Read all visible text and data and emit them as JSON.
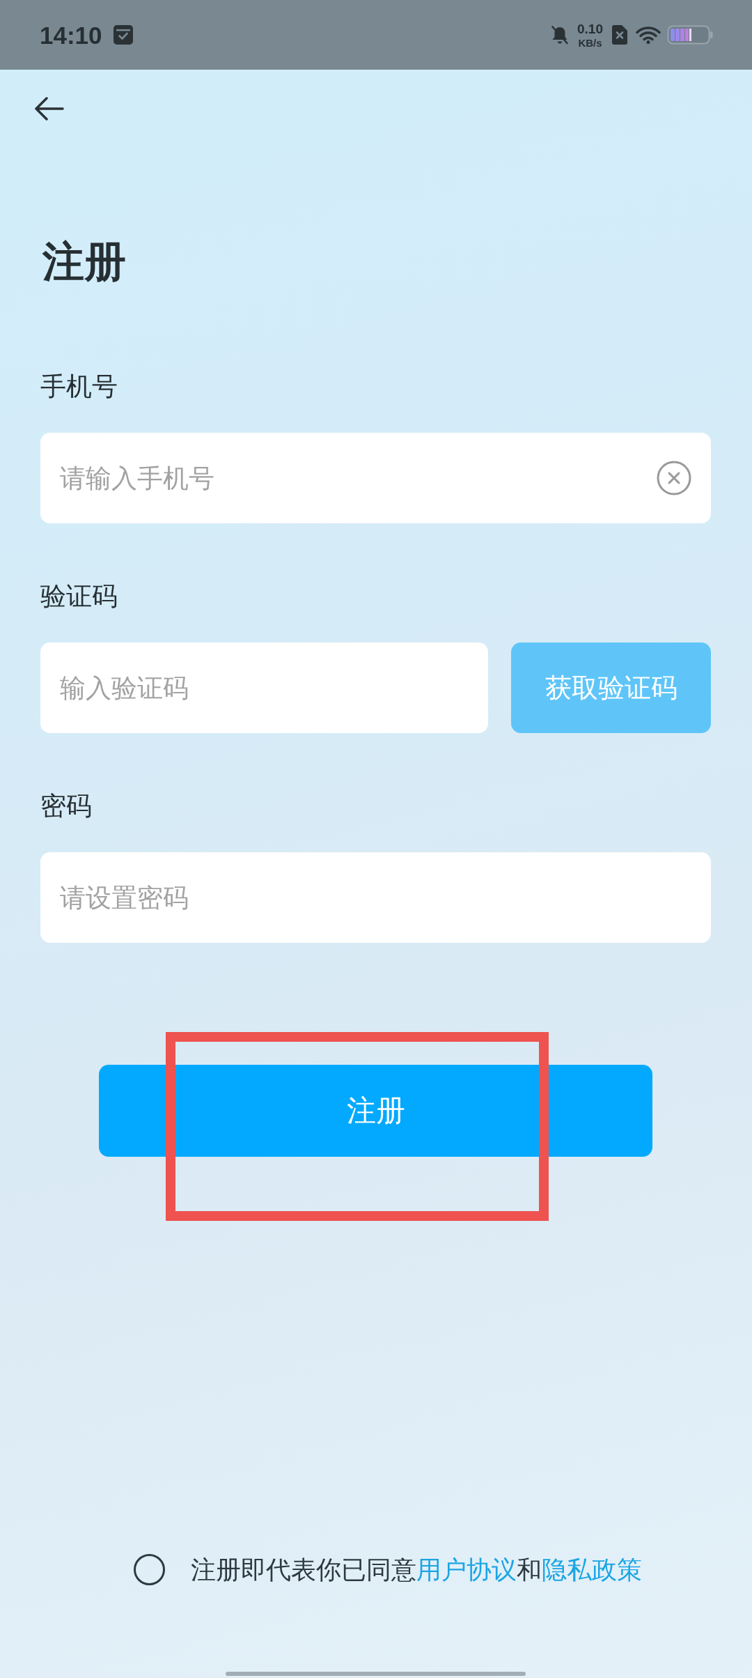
{
  "status_bar": {
    "time": "14:10",
    "net_speed": "0.10",
    "net_speed_unit": "KB/s"
  },
  "title": "注册",
  "fields": [
    {
      "label": "手机号",
      "placeholder": "请输入手机号",
      "clear_button": true
    },
    {
      "label": "验证码",
      "placeholder": "输入验证码",
      "action_button": "获取验证码"
    },
    {
      "label": "密码",
      "placeholder": "请设置密码"
    }
  ],
  "submit_button": "注册",
  "agreement": {
    "checked": false,
    "parts": [
      {
        "kind": "text",
        "text": "注册即代表你已同意"
      },
      {
        "kind": "link",
        "text": "用户协议"
      },
      {
        "kind": "text",
        "text": "和"
      },
      {
        "kind": "link",
        "text": "隐私政策"
      }
    ]
  },
  "annotation": {
    "kind": "rectangle"
  }
}
